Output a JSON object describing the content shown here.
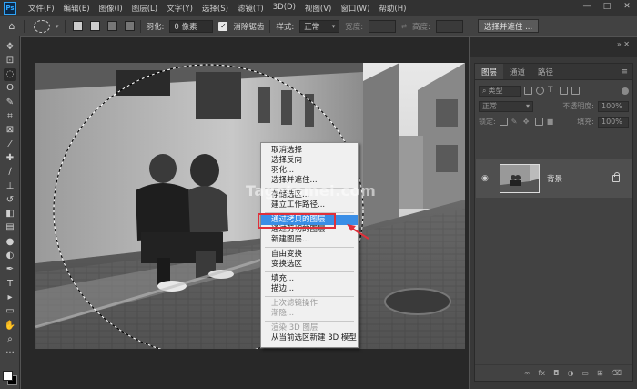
{
  "app": {
    "logo": "Ps"
  },
  "menubar": {
    "items": [
      "文件(F)",
      "编辑(E)",
      "图像(I)",
      "图层(L)",
      "文字(Y)",
      "选择(S)",
      "滤镜(T)",
      "3D(D)",
      "视图(V)",
      "窗口(W)",
      "帮助(H)"
    ],
    "window_controls": [
      "—",
      "□",
      "✕"
    ]
  },
  "options_bar": {
    "feather_label": "羽化:",
    "feather_value": "0 像素",
    "antialias_label": "消除锯齿",
    "antialias_checked": true,
    "style_label": "样式:",
    "style_value": "正常",
    "width_label": "宽度:",
    "height_label": "高度:",
    "select_mask_button": "选择并遮住 ..."
  },
  "toolbox": {
    "tools": [
      {
        "name": "move-tool-icon",
        "glyph": "✥"
      },
      {
        "name": "artboard-tool-icon",
        "glyph": "⊡"
      },
      {
        "name": "elliptical-marquee-tool-icon",
        "glyph": "◌"
      },
      {
        "name": "lasso-tool-icon",
        "glyph": "ʘ"
      },
      {
        "name": "quick-select-tool-icon",
        "glyph": "✎"
      },
      {
        "name": "crop-tool-icon",
        "glyph": "⌗"
      },
      {
        "name": "frame-tool-icon",
        "glyph": "⊠"
      },
      {
        "name": "eyedropper-tool-icon",
        "glyph": "⁄"
      },
      {
        "name": "healing-brush-tool-icon",
        "glyph": "✚"
      },
      {
        "name": "brush-tool-icon",
        "glyph": "∕"
      },
      {
        "name": "clone-stamp-tool-icon",
        "glyph": "⊥"
      },
      {
        "name": "history-brush-tool-icon",
        "glyph": "↺"
      },
      {
        "name": "eraser-tool-icon",
        "glyph": "◧"
      },
      {
        "name": "gradient-tool-icon",
        "glyph": "▤"
      },
      {
        "name": "blur-tool-icon",
        "glyph": "●"
      },
      {
        "name": "dodge-tool-icon",
        "glyph": "◐"
      },
      {
        "name": "pen-tool-icon",
        "glyph": "✒"
      },
      {
        "name": "type-tool-icon",
        "glyph": "T"
      },
      {
        "name": "path-select-tool-icon",
        "glyph": "▸"
      },
      {
        "name": "rectangle-tool-icon",
        "glyph": "▭"
      },
      {
        "name": "hand-tool-icon",
        "glyph": "✋"
      },
      {
        "name": "zoom-tool-icon",
        "glyph": "⌕"
      },
      {
        "name": "more-tools-icon",
        "glyph": "···"
      }
    ]
  },
  "layers_panel": {
    "tabs": [
      "图层",
      "通道",
      "路径"
    ],
    "active_tab": "图层",
    "filter_kind": "类型",
    "blend_mode": "正常",
    "opacity_label": "不透明度:",
    "opacity_value": "100%",
    "lock_label": "锁定:",
    "fill_label": "填充:",
    "fill_value": "100%",
    "layers": [
      {
        "name": "背景",
        "visible": true,
        "locked": true
      }
    ],
    "footer_icons": [
      "link-icon",
      "fx-icon",
      "mask-icon",
      "adjustment-icon",
      "folder-icon",
      "new-layer-icon",
      "trash-icon"
    ]
  },
  "context_menu": {
    "items": [
      {
        "label": "取消选择",
        "enabled": true
      },
      {
        "label": "选择反向",
        "enabled": true
      },
      {
        "label": "羽化...",
        "enabled": true
      },
      {
        "label": "选择并遮住...",
        "enabled": true
      },
      {
        "sep": true
      },
      {
        "label": "存储选区...",
        "enabled": true
      },
      {
        "label": "建立工作路径...",
        "enabled": true
      },
      {
        "sep": true
      },
      {
        "label": "通过拷贝的图层",
        "enabled": true,
        "highlighted": true
      },
      {
        "label": "通过剪切的图层",
        "enabled": true
      },
      {
        "label": "新建图层...",
        "enabled": true
      },
      {
        "sep": true
      },
      {
        "label": "自由变换",
        "enabled": true
      },
      {
        "label": "变换选区",
        "enabled": true
      },
      {
        "sep": true
      },
      {
        "label": "填充...",
        "enabled": true
      },
      {
        "label": "描边...",
        "enabled": true
      },
      {
        "sep": true
      },
      {
        "label": "上次滤镜操作",
        "enabled": false
      },
      {
        "label": "渐隐...",
        "enabled": false
      },
      {
        "sep": true
      },
      {
        "label": "渲染 3D 图层",
        "enabled": false
      },
      {
        "label": "从当前选区新建 3D 模型",
        "enabled": true
      }
    ]
  },
  "watermark": "Tagetomei.com",
  "colors": {
    "accent_highlight": "#3a8ee6",
    "annotation_red": "#e0303a",
    "ps_blue": "#31a8ff"
  }
}
